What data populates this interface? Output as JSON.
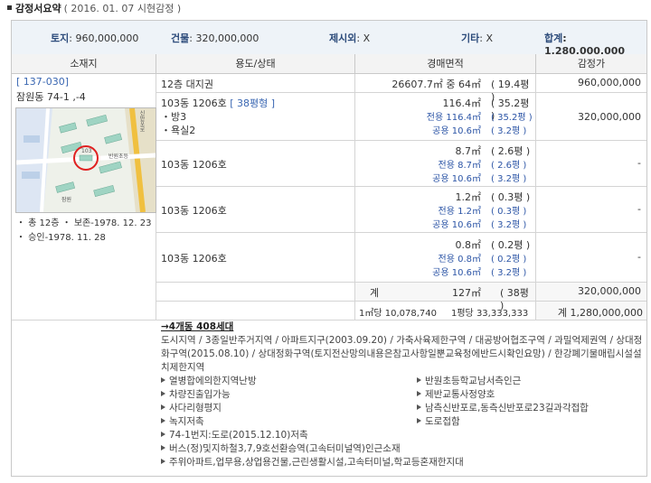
{
  "header": {
    "title": "감정서요약",
    "date": "( 2016. 01. 07  시현감정 )"
  },
  "summary": {
    "land_label": "토지",
    "land_value": ": 960,000,000",
    "building_label": "건물",
    "building_value": ": 320,000,000",
    "excluded_label": "제시외",
    "excluded_value": ": X",
    "other_label": "기타",
    "other_value": ": X",
    "total_label": "합계",
    "total_value": ": 1,280,000,000"
  },
  "columns": {
    "location": "소재지",
    "usage": "용도/상태",
    "area": "경매면적",
    "appraisal": "감정가"
  },
  "location": {
    "code": "[ 137-030]",
    "address": "잠원동 74-1 ,-4",
    "facts": [
      "・ 총 12층  ・ 보존-1978. 12. 23",
      "・ 승인-1978. 11. 28"
    ]
  },
  "rows": [
    {
      "usage": "12층  대지권",
      "area": "26607.7㎡ 중 64㎡",
      "pyeong": "( 19.4평 )",
      "price": "960,000,000"
    },
    {
      "usage": "103동 1206호",
      "usage_tag": "[ 38평형 ]",
      "usage_items": [
        "・방3",
        "・욕실2"
      ],
      "area": "116.4㎡",
      "pyeong": "( 35.2평 )",
      "exclusive": "전용 116.4㎡",
      "exclusive_p": "( 35.2평 )",
      "common": "공용 10.6㎡",
      "common_p": "( 3.2평 )",
      "price": "320,000,000"
    },
    {
      "usage": "103동 1206호",
      "area": "8.7㎡",
      "pyeong": "( 2.6평 )",
      "exclusive": "전용 8.7㎡",
      "exclusive_p": "( 2.6평 )",
      "common": "공용 10.6㎡",
      "common_p": "( 3.2평 )",
      "price": "-"
    },
    {
      "usage": "103동 1206호",
      "area": "1.2㎡",
      "pyeong": "( 0.3평 )",
      "exclusive": "전용 1.2㎡",
      "exclusive_p": "( 0.3평 )",
      "common": "공용 10.6㎡",
      "common_p": "( 3.2평 )",
      "price": "-"
    },
    {
      "usage": "103동 1206호",
      "area": "0.8㎡",
      "pyeong": "( 0.2평 )",
      "exclusive": "전용 0.8㎡",
      "exclusive_p": "( 0.2평 )",
      "common": "공용 10.6㎡",
      "common_p": "( 3.2평 )",
      "price": "-"
    }
  ],
  "totals": {
    "label": "계",
    "area": "127㎡",
    "pyeong": "( 38평 )",
    "price": "320,000,000",
    "per_sqm": "1㎡당 10,078,740",
    "per_pyeong": "1평당 33,333,333",
    "grand": "계   1,280,000,000"
  },
  "notes": {
    "link": "→4개동 408세대",
    "zoning": "도시지역 / 3종일반주거지역 / 아파트지구(2003.09.20) / 가축사육제한구역 / 대공방어협조구역 / 과밀억제권역 / 상대정화구역(2015.08.10) / 상대정화구역(토지전산망의내용은참고사항일뿐교육청에반드시확인요망) / 한강폐기물매립시설설치제한지역",
    "left": [
      "열병합에의한지역난방",
      "차량진출입가능",
      "사다리형평지",
      "녹지저촉",
      "74-1번지:도로(2015.12.10)저촉",
      "버스(정)및지하철3,7,9호선환승역(고속터미널역)인근소재",
      "주위아파트,업무용,상업용건물,근린생활시설,고속터미널,학교등혼재한지대"
    ],
    "right": [
      "반원초등학교남서측인근",
      "제반교통사정양호",
      "남측신반포로,동측신반포로23길과각접합",
      "도로접함"
    ]
  },
  "map": {
    "building_label": "103",
    "labels": [
      "반원초등",
      "잠원",
      "신반포로"
    ]
  }
}
